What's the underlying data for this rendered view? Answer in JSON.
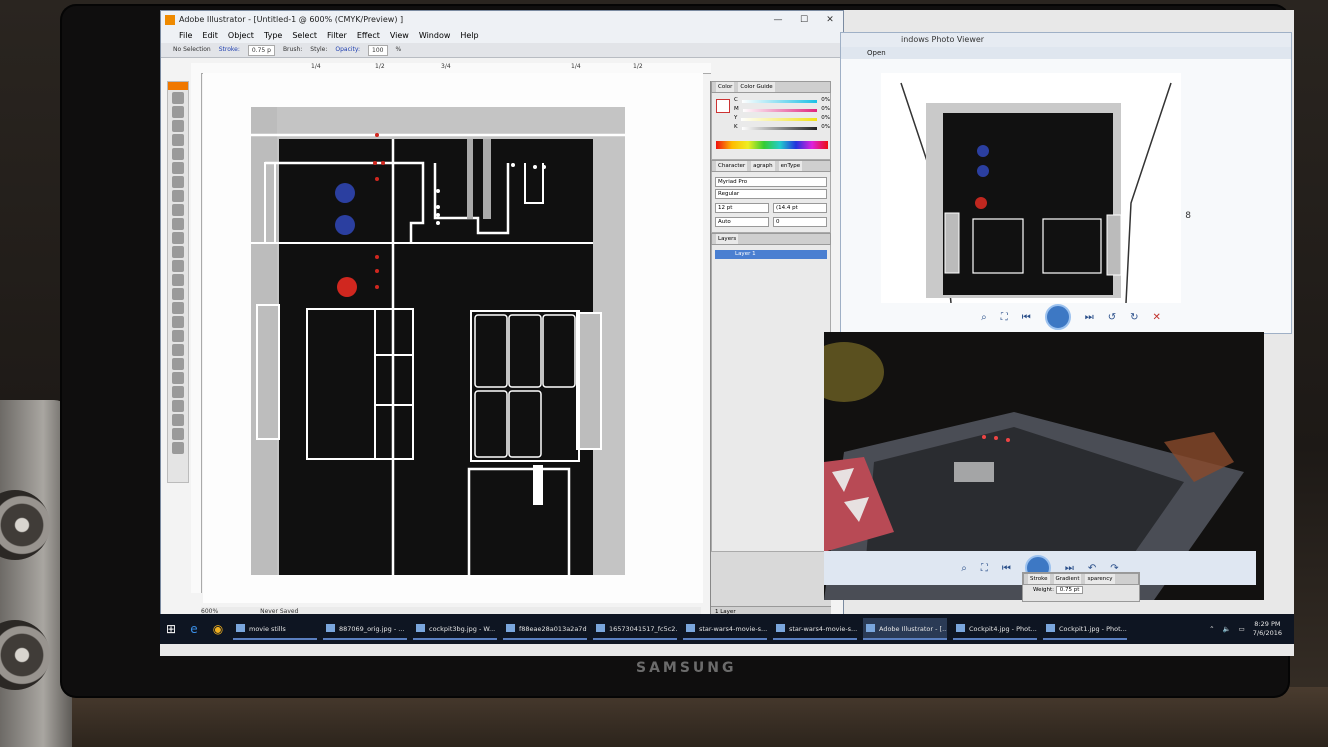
{
  "monitor": {
    "brand": "SAMSUNG"
  },
  "illustrator": {
    "title": "Adobe Illustrator - [Untitled-1 @ 600% (CMYK/Preview) ]",
    "menu": [
      "File",
      "Edit",
      "Object",
      "Type",
      "Select",
      "Filter",
      "Effect",
      "View",
      "Window",
      "Help"
    ],
    "control": {
      "selection": "No Selection",
      "stroke_label": "Stroke:",
      "stroke_value": "0.75 p",
      "brush_label": "Brush:",
      "style_label": "Style:",
      "opacity_label": "Opacity:",
      "opacity_value": "100",
      "opacity_unit": "%"
    },
    "ruler_marks": [
      "1/4",
      "1/2",
      "3/4",
      "1/4",
      "1/2"
    ],
    "status": {
      "zoom": "600%",
      "saved": "Never Saved"
    }
  },
  "panels": {
    "color": {
      "tabs": [
        "Color",
        "Color Guide"
      ],
      "channels": [
        {
          "label": "C",
          "value": "0",
          "unit": "%",
          "color": "#1ec0e6"
        },
        {
          "label": "M",
          "value": "0",
          "unit": "%",
          "color": "#e0257d"
        },
        {
          "label": "Y",
          "value": "0",
          "unit": "%",
          "color": "#f1e21a"
        },
        {
          "label": "K",
          "value": "0",
          "unit": "%",
          "color": "#222222"
        }
      ]
    },
    "character": {
      "tabs": [
        "Character",
        "agraph",
        "enType"
      ],
      "font": "Myriad Pro",
      "style": "Regular",
      "size": "12 pt",
      "leading": "(14.4 pt",
      "kerning": "Auto",
      "tracking": "0"
    },
    "layers": {
      "tab": "Layers",
      "layer_name": "Layer 1",
      "count": "1 Layer"
    }
  },
  "photo_viewer": {
    "title": "indows Photo Viewer",
    "open_label": "Open",
    "dim_label": "8"
  },
  "stroke_panel": {
    "tabs": [
      "Stroke",
      "Gradient",
      "sparency"
    ],
    "weight_label": "Weight:",
    "weight_value": "0.75 pt"
  },
  "taskbar": {
    "items": [
      "movie stills",
      "887069_orig.jpg - ...",
      "cockpit3bg.jpg - W...",
      "f88eae28a013a2a7d...",
      "16573041517_fc5c2...",
      "star-wars4-movie-s...",
      "star-wars4-movie-s...",
      "Adobe Illustrator - [...",
      "Cockpit4.jpg - Phot...",
      "Cockpit1.jpg - Phot..."
    ],
    "time": "8:29 PM",
    "date": "7/6/2016"
  }
}
